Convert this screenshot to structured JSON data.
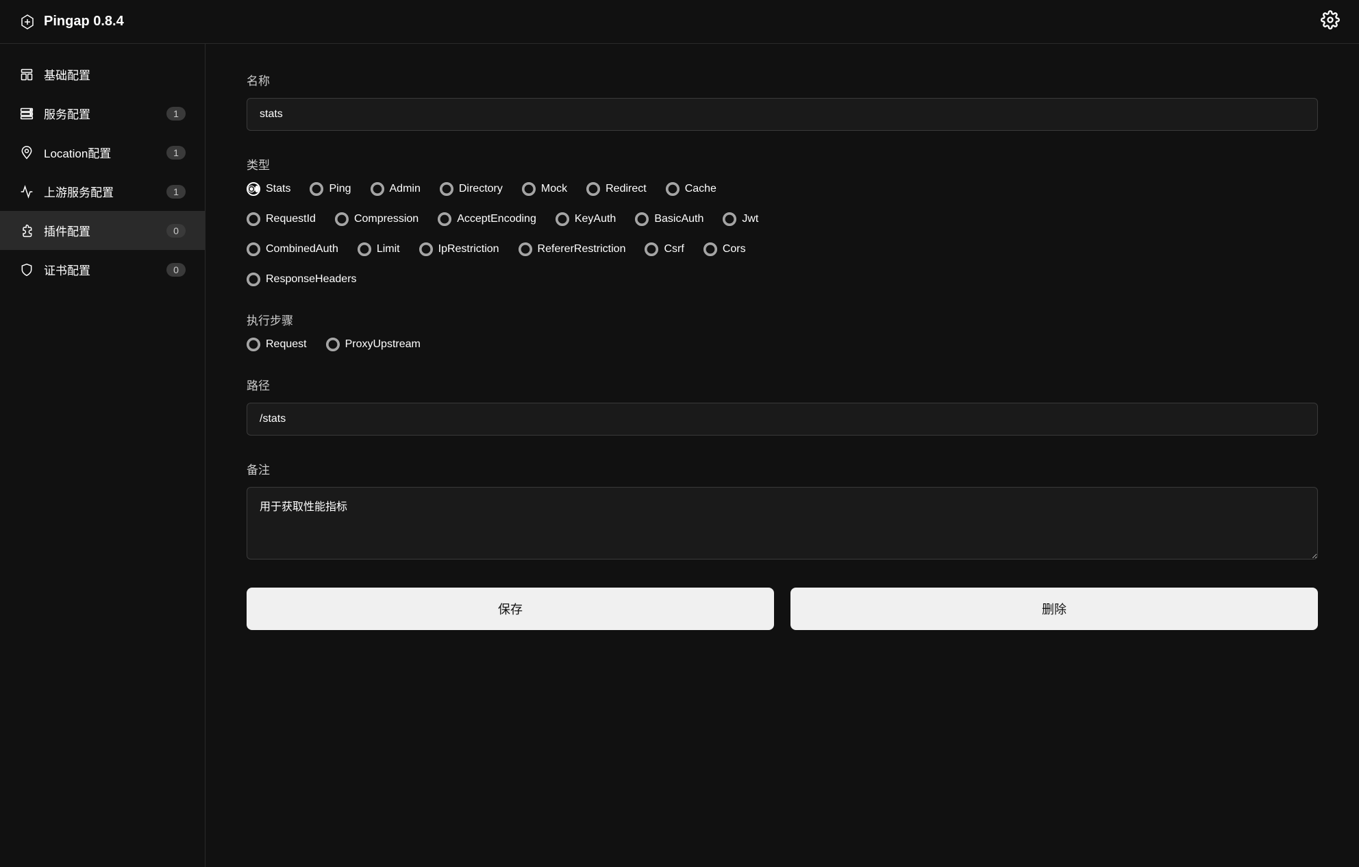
{
  "header": {
    "title": "Pingap  0.8.4",
    "settings_icon": "gear-icon"
  },
  "sidebar": {
    "items": [
      {
        "id": "basic",
        "label": "基础配置",
        "badge": null,
        "icon": "layout-icon"
      },
      {
        "id": "service",
        "label": "服务配置",
        "badge": "1",
        "icon": "server-icon"
      },
      {
        "id": "location",
        "label": "Location配置",
        "badge": "1",
        "icon": "location-icon"
      },
      {
        "id": "upstream",
        "label": "上游服务配置",
        "badge": "1",
        "icon": "upstream-icon"
      },
      {
        "id": "plugin",
        "label": "插件配置",
        "badge": "0",
        "icon": "plugin-icon",
        "active": true
      },
      {
        "id": "cert",
        "label": "证书配置",
        "badge": "0",
        "icon": "cert-icon"
      }
    ]
  },
  "form": {
    "name_label": "名称",
    "name_value": "stats",
    "type_label": "类型",
    "type_options": [
      {
        "id": "Stats",
        "label": "Stats",
        "checked": true
      },
      {
        "id": "Ping",
        "label": "Ping",
        "checked": false
      },
      {
        "id": "Admin",
        "label": "Admin",
        "checked": false
      },
      {
        "id": "Directory",
        "label": "Directory",
        "checked": false
      },
      {
        "id": "Mock",
        "label": "Mock",
        "checked": false
      },
      {
        "id": "Redirect",
        "label": "Redirect",
        "checked": false
      },
      {
        "id": "Cache",
        "label": "Cache",
        "checked": false
      },
      {
        "id": "RequestId",
        "label": "RequestId",
        "checked": false
      },
      {
        "id": "Compression",
        "label": "Compression",
        "checked": false
      },
      {
        "id": "AcceptEncoding",
        "label": "AcceptEncoding",
        "checked": false
      },
      {
        "id": "KeyAuth",
        "label": "KeyAuth",
        "checked": false
      },
      {
        "id": "BasicAuth",
        "label": "BasicAuth",
        "checked": false
      },
      {
        "id": "Jwt",
        "label": "Jwt",
        "checked": false
      },
      {
        "id": "CombinedAuth",
        "label": "CombinedAuth",
        "checked": false
      },
      {
        "id": "Limit",
        "label": "Limit",
        "checked": false
      },
      {
        "id": "IpRestriction",
        "label": "IpRestriction",
        "checked": false
      },
      {
        "id": "RefererRestriction",
        "label": "RefererRestriction",
        "checked": false
      },
      {
        "id": "Csrf",
        "label": "Csrf",
        "checked": false
      },
      {
        "id": "Cors",
        "label": "Cors",
        "checked": false
      },
      {
        "id": "ResponseHeaders",
        "label": "ResponseHeaders",
        "checked": false
      }
    ],
    "step_label": "执行步骤",
    "step_options": [
      {
        "id": "Request",
        "label": "Request",
        "checked": false
      },
      {
        "id": "ProxyUpstream",
        "label": "ProxyUpstream",
        "checked": false
      }
    ],
    "path_label": "路径",
    "path_value": "/stats",
    "remark_label": "备注",
    "remark_value": "用于获取性能指标",
    "save_label": "保存",
    "delete_label": "删除"
  }
}
